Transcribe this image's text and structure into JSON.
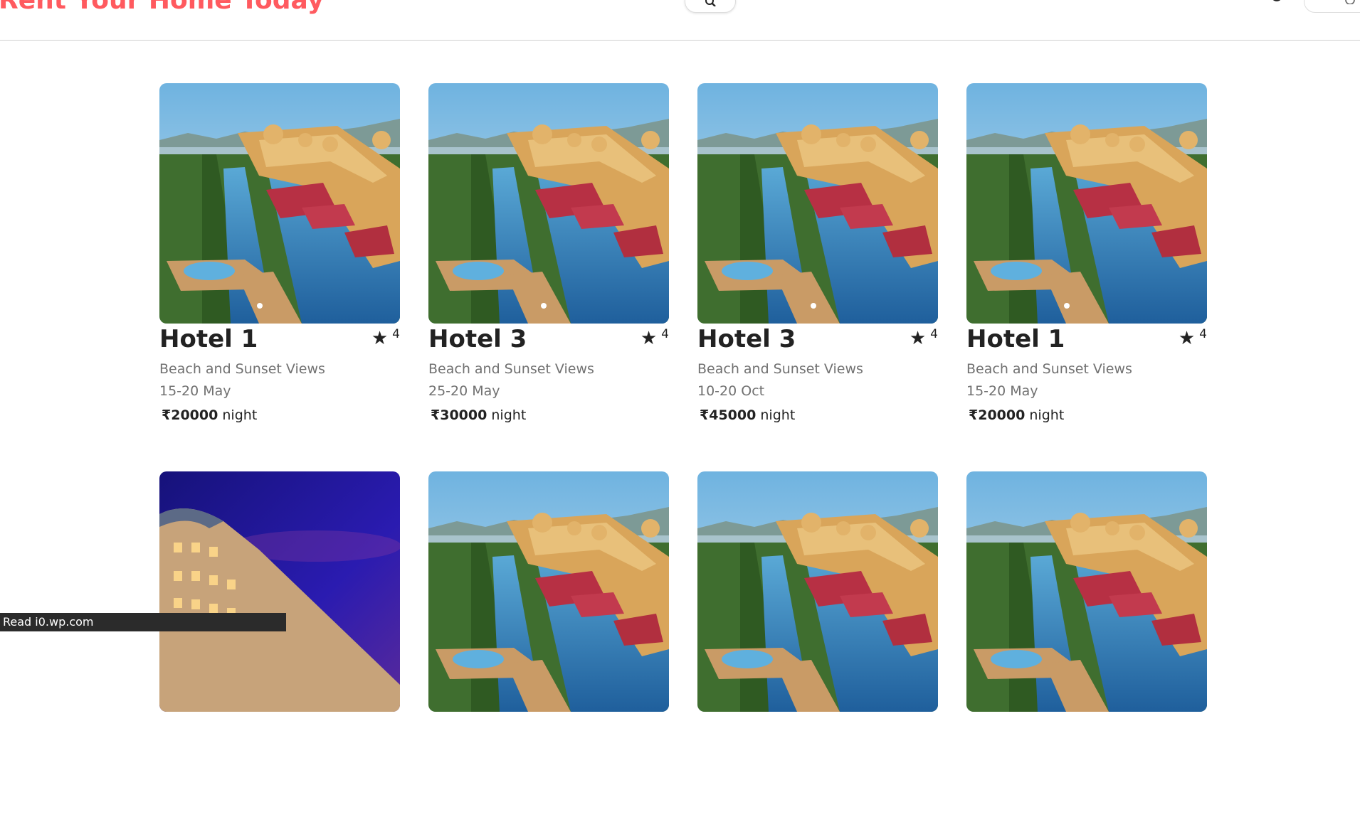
{
  "header": {
    "brand": "Rent Your Home Today",
    "icons": {
      "search": "search-icon",
      "globe": "globe-icon",
      "user": "user-icon"
    }
  },
  "listings": [
    {
      "title": "Hotel 1",
      "rating": "4",
      "description": "Beach and Sunset Views",
      "dates": "15-20 May",
      "currency": "₹",
      "price": "20000",
      "unit": "night",
      "image": "palace-pool"
    },
    {
      "title": "Hotel 3",
      "rating": "4",
      "description": "Beach and Sunset Views",
      "dates": "25-20 May",
      "currency": "₹",
      "price": "30000",
      "unit": "night",
      "image": "palace-pool"
    },
    {
      "title": "Hotel 3",
      "rating": "4",
      "description": "Beach and Sunset Views",
      "dates": "10-20 Oct",
      "currency": "₹",
      "price": "45000",
      "unit": "night",
      "image": "palace-pool"
    },
    {
      "title": "Hotel 1",
      "rating": "4",
      "description": "Beach and Sunset Views",
      "dates": "15-20 May",
      "currency": "₹",
      "price": "20000",
      "unit": "night",
      "image": "palace-pool"
    },
    {
      "image": "hotel-night"
    },
    {
      "image": "palace-pool"
    },
    {
      "image": "palace-pool"
    },
    {
      "image": "palace-pool"
    }
  ],
  "status_bar": {
    "text": "Read i0.wp.com"
  },
  "colors": {
    "brand": "#ff5a5f",
    "text": "#222222",
    "muted": "#717171",
    "status_bg": "#2b2b2b"
  }
}
